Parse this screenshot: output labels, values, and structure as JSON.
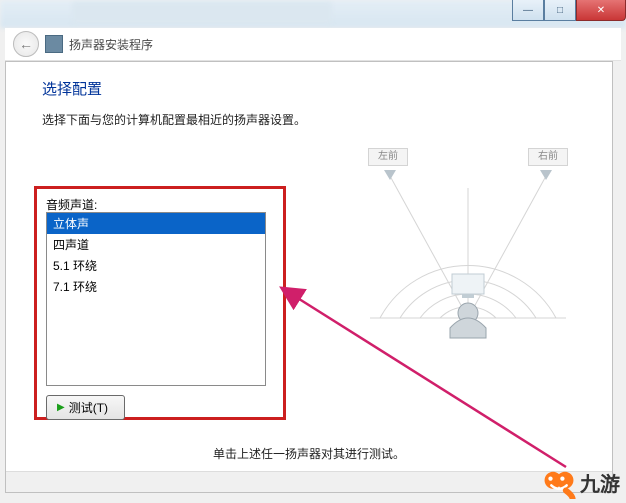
{
  "window": {
    "back_tooltip": "返回",
    "app_title": "扬声器安装程序"
  },
  "titlebar": {
    "minimize": "—",
    "maximize": "□",
    "close": "✕"
  },
  "page": {
    "heading": "选择配置",
    "subheading": "选择下面与您的计算机配置最相近的扬声器设置。"
  },
  "channel": {
    "label": "音频声道:",
    "options": [
      "立体声",
      "四声道",
      "5.1 环绕",
      "7.1 环绕"
    ],
    "selected_index": 0
  },
  "test_button": "测试(T)",
  "diagram": {
    "left_front": "左前",
    "right_front": "右前"
  },
  "hint": "单击上述任一扬声器对其进行测试。",
  "watermark": {
    "text": "九游"
  },
  "colors": {
    "heading": "#003399",
    "selection": "#0a64c8",
    "highlight_box": "#cc1f1f",
    "close_btn": "#c93636",
    "arrow": "#d01f6a",
    "logo": "#ff7a1a"
  }
}
